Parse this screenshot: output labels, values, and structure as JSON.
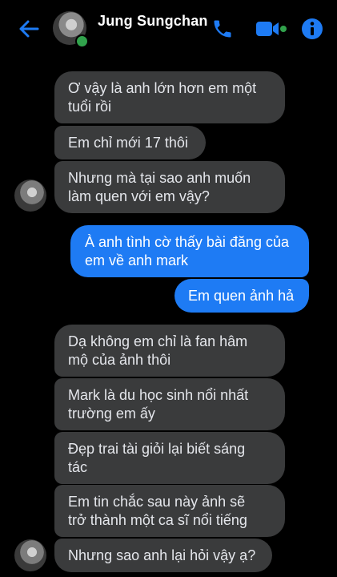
{
  "header": {
    "contact_name": "Jung Sungchan"
  },
  "messages": [
    {
      "side": "in",
      "text": "Ơ vậy là anh lớn hơn em một\ntuổi rồi"
    },
    {
      "side": "in",
      "text": "Em chỉ mới 17 thôi"
    },
    {
      "side": "in",
      "text": "Nhưng mà tại sao anh muốn\nlàm quen với em vậy?"
    },
    {
      "side": "out",
      "text": "À anh tình cờ thấy bài đăng của\nem về anh mark"
    },
    {
      "side": "out",
      "text": "Em quen ảnh hả"
    },
    {
      "side": "in",
      "text": "Dạ không em chỉ là fan hâm\nmộ của ảnh thôi"
    },
    {
      "side": "in",
      "text": "Mark là du học sinh nổi nhất\ntrường em ấy"
    },
    {
      "side": "in",
      "text": "Đẹp trai tài giỏi lại biết sáng\ntác"
    },
    {
      "side": "in",
      "text": "Em tin chắc sau này ảnh sẽ\ntrở thành một ca sĩ nổi tiếng"
    },
    {
      "side": "in",
      "text": "Nhưng sao anh lại hỏi vậy ạ?"
    }
  ],
  "colors": {
    "accent": "#1e7bf4",
    "incoming_bubble": "#3a3b3c",
    "online": "#31a24c"
  }
}
